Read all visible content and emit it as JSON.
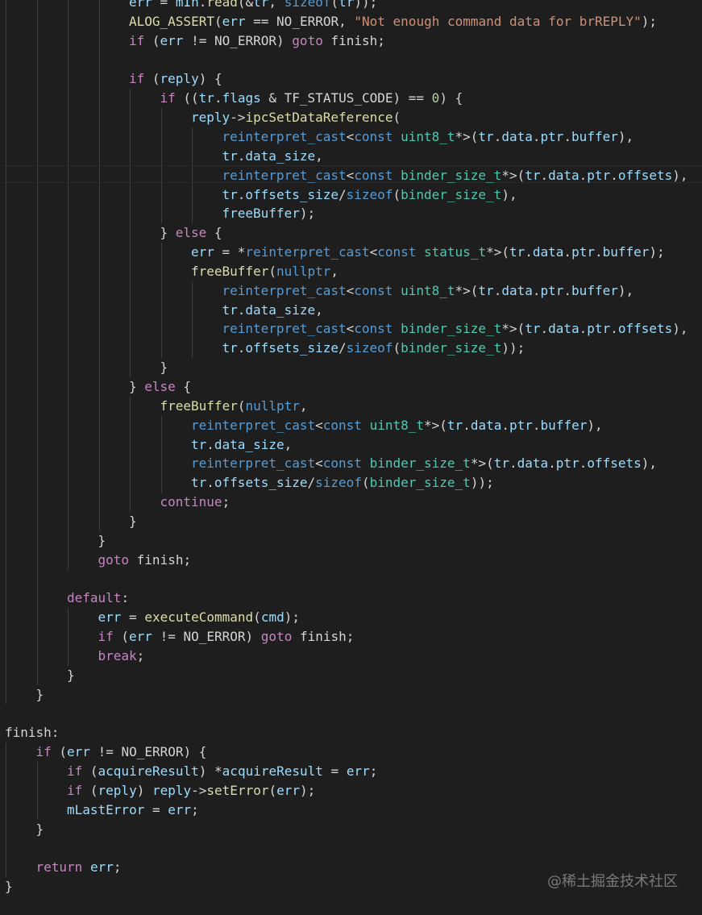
{
  "colors": {
    "background": "#1e1e1e",
    "text": "#d4d4d4",
    "keyword": "#c586c0",
    "type_keyword": "#569cd6",
    "function": "#dcdcaa",
    "variable": "#9cdcfe",
    "string": "#ce9178",
    "number": "#b5cea8",
    "type": "#4ec9b0",
    "indent_guide": "#404040"
  },
  "watermark": "@稀土掘金技术社区",
  "lines": [
    {
      "indent": 4,
      "tokens": [
        [
          "var",
          "err"
        ],
        [
          "p",
          " = "
        ],
        [
          "var",
          "mIn"
        ],
        [
          "p",
          "."
        ],
        [
          "fn",
          "read"
        ],
        [
          "p",
          "(&"
        ],
        [
          "var",
          "tr"
        ],
        [
          "p",
          ", "
        ],
        [
          "kwb",
          "sizeof"
        ],
        [
          "p",
          "("
        ],
        [
          "var",
          "tr"
        ],
        [
          "p",
          "));"
        ]
      ]
    },
    {
      "indent": 4,
      "tokens": [
        [
          "fn",
          "ALOG_ASSERT"
        ],
        [
          "p",
          "("
        ],
        [
          "var",
          "err"
        ],
        [
          "p",
          " == NO_ERROR, "
        ],
        [
          "str",
          "\"Not enough command data for brREPLY\""
        ],
        [
          "p",
          ");"
        ]
      ]
    },
    {
      "indent": 4,
      "tokens": [
        [
          "kw",
          "if"
        ],
        [
          "p",
          " ("
        ],
        [
          "var",
          "err"
        ],
        [
          "p",
          " != NO_ERROR) "
        ],
        [
          "kw",
          "goto"
        ],
        [
          "p",
          " finish;"
        ]
      ]
    },
    {
      "indent": 0,
      "tokens": []
    },
    {
      "indent": 4,
      "tokens": [
        [
          "kw",
          "if"
        ],
        [
          "p",
          " ("
        ],
        [
          "var",
          "reply"
        ],
        [
          "p",
          ") {"
        ]
      ]
    },
    {
      "indent": 5,
      "tokens": [
        [
          "kw",
          "if"
        ],
        [
          "p",
          " (("
        ],
        [
          "var",
          "tr"
        ],
        [
          "p",
          "."
        ],
        [
          "var",
          "flags"
        ],
        [
          "p",
          " & TF_STATUS_CODE) == "
        ],
        [
          "num",
          "0"
        ],
        [
          "p",
          ") {"
        ]
      ]
    },
    {
      "indent": 6,
      "tokens": [
        [
          "var",
          "reply"
        ],
        [
          "p",
          "->"
        ],
        [
          "fn",
          "ipcSetDataReference"
        ],
        [
          "p",
          "("
        ]
      ]
    },
    {
      "indent": 7,
      "tokens": [
        [
          "kwb",
          "reinterpret_cast"
        ],
        [
          "p",
          "<"
        ],
        [
          "kwb",
          "const"
        ],
        [
          "p",
          " "
        ],
        [
          "type",
          "uint8_t"
        ],
        [
          "p",
          "*>("
        ],
        [
          "var",
          "tr"
        ],
        [
          "p",
          "."
        ],
        [
          "var",
          "data"
        ],
        [
          "p",
          "."
        ],
        [
          "var",
          "ptr"
        ],
        [
          "p",
          "."
        ],
        [
          "var",
          "buffer"
        ],
        [
          "p",
          "),"
        ]
      ]
    },
    {
      "indent": 7,
      "tokens": [
        [
          "var",
          "tr"
        ],
        [
          "p",
          "."
        ],
        [
          "var",
          "data_size"
        ],
        [
          "p",
          ","
        ]
      ]
    },
    {
      "indent": 7,
      "tokens": [
        [
          "kwb",
          "reinterpret_cast"
        ],
        [
          "p",
          "<"
        ],
        [
          "kwb",
          "const"
        ],
        [
          "p",
          " "
        ],
        [
          "type",
          "binder_size_t"
        ],
        [
          "p",
          "*>("
        ],
        [
          "var",
          "tr"
        ],
        [
          "p",
          "."
        ],
        [
          "var",
          "data"
        ],
        [
          "p",
          "."
        ],
        [
          "var",
          "ptr"
        ],
        [
          "p",
          "."
        ],
        [
          "var",
          "offsets"
        ],
        [
          "p",
          "),"
        ]
      ]
    },
    {
      "indent": 7,
      "tokens": [
        [
          "var",
          "tr"
        ],
        [
          "p",
          "."
        ],
        [
          "var",
          "offsets_size"
        ],
        [
          "p",
          "/"
        ],
        [
          "kwb",
          "sizeof"
        ],
        [
          "p",
          "("
        ],
        [
          "type",
          "binder_size_t"
        ],
        [
          "p",
          "),"
        ]
      ]
    },
    {
      "indent": 7,
      "tokens": [
        [
          "var",
          "freeBuffer"
        ],
        [
          "p",
          ");"
        ]
      ]
    },
    {
      "indent": 5,
      "tokens": [
        [
          "p",
          "} "
        ],
        [
          "kw",
          "else"
        ],
        [
          "p",
          " {"
        ]
      ]
    },
    {
      "indent": 6,
      "tokens": [
        [
          "var",
          "err"
        ],
        [
          "p",
          " = *"
        ],
        [
          "kwb",
          "reinterpret_cast"
        ],
        [
          "p",
          "<"
        ],
        [
          "kwb",
          "const"
        ],
        [
          "p",
          " "
        ],
        [
          "type",
          "status_t"
        ],
        [
          "p",
          "*>("
        ],
        [
          "var",
          "tr"
        ],
        [
          "p",
          "."
        ],
        [
          "var",
          "data"
        ],
        [
          "p",
          "."
        ],
        [
          "var",
          "ptr"
        ],
        [
          "p",
          "."
        ],
        [
          "var",
          "buffer"
        ],
        [
          "p",
          ");"
        ]
      ]
    },
    {
      "indent": 6,
      "tokens": [
        [
          "fn",
          "freeBuffer"
        ],
        [
          "p",
          "("
        ],
        [
          "kwb",
          "nullptr"
        ],
        [
          "p",
          ","
        ]
      ]
    },
    {
      "indent": 7,
      "tokens": [
        [
          "kwb",
          "reinterpret_cast"
        ],
        [
          "p",
          "<"
        ],
        [
          "kwb",
          "const"
        ],
        [
          "p",
          " "
        ],
        [
          "type",
          "uint8_t"
        ],
        [
          "p",
          "*>("
        ],
        [
          "var",
          "tr"
        ],
        [
          "p",
          "."
        ],
        [
          "var",
          "data"
        ],
        [
          "p",
          "."
        ],
        [
          "var",
          "ptr"
        ],
        [
          "p",
          "."
        ],
        [
          "var",
          "buffer"
        ],
        [
          "p",
          "),"
        ]
      ]
    },
    {
      "indent": 7,
      "tokens": [
        [
          "var",
          "tr"
        ],
        [
          "p",
          "."
        ],
        [
          "var",
          "data_size"
        ],
        [
          "p",
          ","
        ]
      ]
    },
    {
      "indent": 7,
      "tokens": [
        [
          "kwb",
          "reinterpret_cast"
        ],
        [
          "p",
          "<"
        ],
        [
          "kwb",
          "const"
        ],
        [
          "p",
          " "
        ],
        [
          "type",
          "binder_size_t"
        ],
        [
          "p",
          "*>("
        ],
        [
          "var",
          "tr"
        ],
        [
          "p",
          "."
        ],
        [
          "var",
          "data"
        ],
        [
          "p",
          "."
        ],
        [
          "var",
          "ptr"
        ],
        [
          "p",
          "."
        ],
        [
          "var",
          "offsets"
        ],
        [
          "p",
          "),"
        ]
      ]
    },
    {
      "indent": 7,
      "tokens": [
        [
          "var",
          "tr"
        ],
        [
          "p",
          "."
        ],
        [
          "var",
          "offsets_size"
        ],
        [
          "p",
          "/"
        ],
        [
          "kwb",
          "sizeof"
        ],
        [
          "p",
          "("
        ],
        [
          "type",
          "binder_size_t"
        ],
        [
          "p",
          "));"
        ]
      ]
    },
    {
      "indent": 5,
      "tokens": [
        [
          "p",
          "}"
        ]
      ]
    },
    {
      "indent": 4,
      "tokens": [
        [
          "p",
          "} "
        ],
        [
          "kw",
          "else"
        ],
        [
          "p",
          " {"
        ]
      ]
    },
    {
      "indent": 5,
      "tokens": [
        [
          "fn",
          "freeBuffer"
        ],
        [
          "p",
          "("
        ],
        [
          "kwb",
          "nullptr"
        ],
        [
          "p",
          ","
        ]
      ]
    },
    {
      "indent": 6,
      "tokens": [
        [
          "kwb",
          "reinterpret_cast"
        ],
        [
          "p",
          "<"
        ],
        [
          "kwb",
          "const"
        ],
        [
          "p",
          " "
        ],
        [
          "type",
          "uint8_t"
        ],
        [
          "p",
          "*>("
        ],
        [
          "var",
          "tr"
        ],
        [
          "p",
          "."
        ],
        [
          "var",
          "data"
        ],
        [
          "p",
          "."
        ],
        [
          "var",
          "ptr"
        ],
        [
          "p",
          "."
        ],
        [
          "var",
          "buffer"
        ],
        [
          "p",
          "),"
        ]
      ]
    },
    {
      "indent": 6,
      "tokens": [
        [
          "var",
          "tr"
        ],
        [
          "p",
          "."
        ],
        [
          "var",
          "data_size"
        ],
        [
          "p",
          ","
        ]
      ]
    },
    {
      "indent": 6,
      "tokens": [
        [
          "kwb",
          "reinterpret_cast"
        ],
        [
          "p",
          "<"
        ],
        [
          "kwb",
          "const"
        ],
        [
          "p",
          " "
        ],
        [
          "type",
          "binder_size_t"
        ],
        [
          "p",
          "*>("
        ],
        [
          "var",
          "tr"
        ],
        [
          "p",
          "."
        ],
        [
          "var",
          "data"
        ],
        [
          "p",
          "."
        ],
        [
          "var",
          "ptr"
        ],
        [
          "p",
          "."
        ],
        [
          "var",
          "offsets"
        ],
        [
          "p",
          "),"
        ]
      ]
    },
    {
      "indent": 6,
      "tokens": [
        [
          "var",
          "tr"
        ],
        [
          "p",
          "."
        ],
        [
          "var",
          "offsets_size"
        ],
        [
          "p",
          "/"
        ],
        [
          "kwb",
          "sizeof"
        ],
        [
          "p",
          "("
        ],
        [
          "type",
          "binder_size_t"
        ],
        [
          "p",
          "));"
        ]
      ]
    },
    {
      "indent": 5,
      "tokens": [
        [
          "kw",
          "continue"
        ],
        [
          "p",
          ";"
        ]
      ]
    },
    {
      "indent": 4,
      "tokens": [
        [
          "p",
          "}"
        ]
      ]
    },
    {
      "indent": 3,
      "tokens": [
        [
          "p",
          "}"
        ]
      ]
    },
    {
      "indent": 3,
      "tokens": [
        [
          "kw",
          "goto"
        ],
        [
          "p",
          " finish;"
        ]
      ]
    },
    {
      "indent": 0,
      "tokens": []
    },
    {
      "indent": 2,
      "tokens": [
        [
          "kw",
          "default"
        ],
        [
          "p",
          ":"
        ]
      ]
    },
    {
      "indent": 3,
      "tokens": [
        [
          "var",
          "err"
        ],
        [
          "p",
          " = "
        ],
        [
          "fn",
          "executeCommand"
        ],
        [
          "p",
          "("
        ],
        [
          "var",
          "cmd"
        ],
        [
          "p",
          ");"
        ]
      ]
    },
    {
      "indent": 3,
      "tokens": [
        [
          "kw",
          "if"
        ],
        [
          "p",
          " ("
        ],
        [
          "var",
          "err"
        ],
        [
          "p",
          " != NO_ERROR) "
        ],
        [
          "kw",
          "goto"
        ],
        [
          "p",
          " finish;"
        ]
      ]
    },
    {
      "indent": 3,
      "tokens": [
        [
          "kw",
          "break"
        ],
        [
          "p",
          ";"
        ]
      ]
    },
    {
      "indent": 2,
      "tokens": [
        [
          "p",
          "}"
        ]
      ]
    },
    {
      "indent": 1,
      "tokens": [
        [
          "p",
          "}"
        ]
      ]
    },
    {
      "indent": 0,
      "tokens": []
    },
    {
      "indent": 0,
      "tokens": [
        [
          "p",
          "finish:"
        ]
      ]
    },
    {
      "indent": 1,
      "tokens": [
        [
          "kw",
          "if"
        ],
        [
          "p",
          " ("
        ],
        [
          "var",
          "err"
        ],
        [
          "p",
          " != NO_ERROR) {"
        ]
      ]
    },
    {
      "indent": 2,
      "tokens": [
        [
          "kw",
          "if"
        ],
        [
          "p",
          " ("
        ],
        [
          "var",
          "acquireResult"
        ],
        [
          "p",
          ") *"
        ],
        [
          "var",
          "acquireResult"
        ],
        [
          "p",
          " = "
        ],
        [
          "var",
          "err"
        ],
        [
          "p",
          ";"
        ]
      ]
    },
    {
      "indent": 2,
      "tokens": [
        [
          "kw",
          "if"
        ],
        [
          "p",
          " ("
        ],
        [
          "var",
          "reply"
        ],
        [
          "p",
          ") "
        ],
        [
          "var",
          "reply"
        ],
        [
          "p",
          "->"
        ],
        [
          "fn",
          "setError"
        ],
        [
          "p",
          "("
        ],
        [
          "var",
          "err"
        ],
        [
          "p",
          ");"
        ]
      ]
    },
    {
      "indent": 2,
      "tokens": [
        [
          "var",
          "mLastError"
        ],
        [
          "p",
          " = "
        ],
        [
          "var",
          "err"
        ],
        [
          "p",
          ";"
        ]
      ]
    },
    {
      "indent": 1,
      "tokens": [
        [
          "p",
          "}"
        ]
      ]
    },
    {
      "indent": 0,
      "tokens": []
    },
    {
      "indent": 1,
      "tokens": [
        [
          "kw",
          "return"
        ],
        [
          "p",
          " "
        ],
        [
          "var",
          "err"
        ],
        [
          "p",
          ";"
        ]
      ]
    },
    {
      "indent": 0,
      "tokens": [
        [
          "p",
          "}"
        ]
      ]
    }
  ]
}
